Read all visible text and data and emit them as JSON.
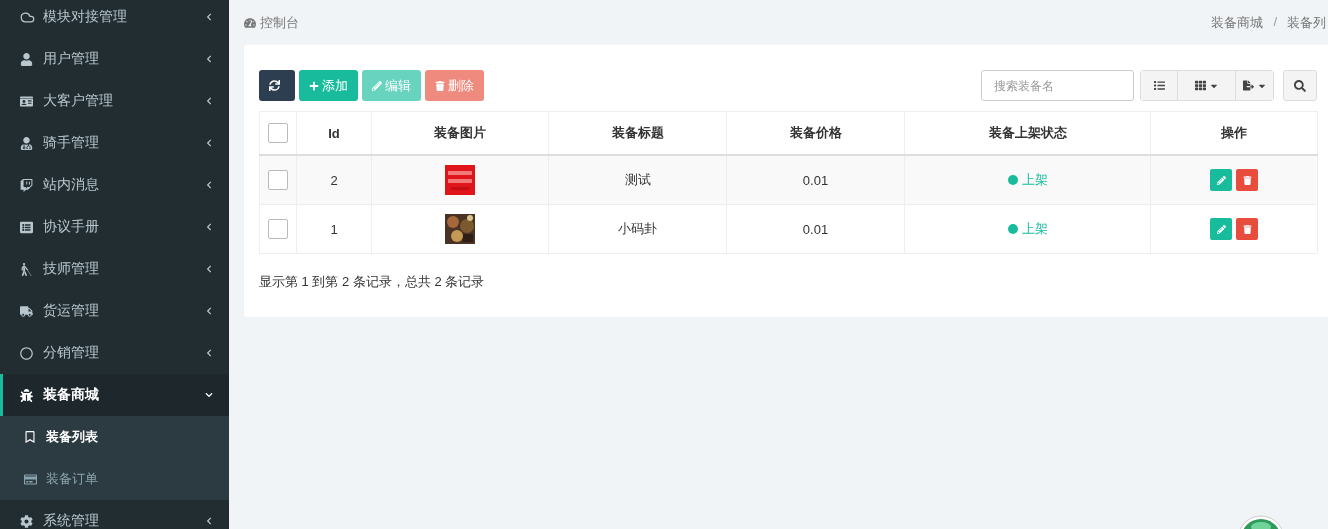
{
  "sidebar": {
    "items": [
      {
        "label": "模块对接管理",
        "selected": false,
        "expanded": false
      },
      {
        "label": "用户管理",
        "selected": false,
        "expanded": false
      },
      {
        "label": "大客户管理",
        "selected": false,
        "expanded": false
      },
      {
        "label": "骑手管理",
        "selected": false,
        "expanded": false
      },
      {
        "label": "站内消息",
        "selected": false,
        "expanded": false
      },
      {
        "label": "协议手册",
        "selected": false,
        "expanded": false
      },
      {
        "label": "技师管理",
        "selected": false,
        "expanded": false
      },
      {
        "label": "货运管理",
        "selected": false,
        "expanded": false
      },
      {
        "label": "分销管理",
        "selected": false,
        "expanded": false
      },
      {
        "label": "装备商城",
        "selected": true,
        "expanded": true,
        "children": [
          {
            "label": "装备列表",
            "selected": true
          },
          {
            "label": "装备订单",
            "selected": false
          }
        ]
      },
      {
        "label": "系统管理",
        "selected": false,
        "expanded": false
      }
    ]
  },
  "header": {
    "title": "控制台",
    "breadcrumb": [
      "装备商城",
      "装备列"
    ],
    "separator": "/"
  },
  "toolbar": {
    "buttons": [
      {
        "kind": "refresh",
        "disabled": false
      },
      {
        "kind": "add",
        "label": "添加",
        "disabled": false
      },
      {
        "kind": "edit",
        "label": "编辑",
        "disabled": true
      },
      {
        "kind": "delete",
        "label": "删除",
        "disabled": true
      }
    ],
    "search": {
      "placeholder": "搜索装备名"
    }
  },
  "table": {
    "select_all": {
      "checked": false
    },
    "columns": [
      "Id",
      "装备图片",
      "装备标题",
      "装备价格",
      "装备上架状态",
      "操作"
    ],
    "rows": [
      {
        "checked": false,
        "id": "2",
        "title": "测试",
        "price": "0.01",
        "status": "上架"
      },
      {
        "checked": false,
        "id": "1",
        "title": "小码卦",
        "price": "0.01",
        "status": "上架"
      }
    ]
  },
  "pagination": {
    "summary": "显示第 1 到第 2 条记录，总共 2 条记录"
  }
}
